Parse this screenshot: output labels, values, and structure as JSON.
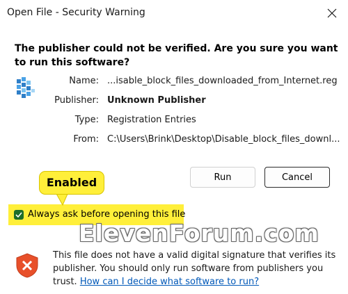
{
  "window": {
    "title": "Open File - Security Warning"
  },
  "question": "The publisher could not be verified.  Are you sure you want to run this software?",
  "details": [
    {
      "label": "Name:",
      "value": "...isable_block_files_downloaded_from_Internet.reg",
      "bold": false
    },
    {
      "label": "Publisher:",
      "value": "Unknown Publisher",
      "bold": true
    },
    {
      "label": "Type:",
      "value": "Registration Entries",
      "bold": false
    },
    {
      "label": "From:",
      "value": "C:\\Users\\Brink\\Desktop\\Disable_block_files_downl...",
      "bold": false
    }
  ],
  "buttons": {
    "run": "Run",
    "cancel": "Cancel"
  },
  "callout": {
    "text": "Enabled",
    "color": "#ffef3a"
  },
  "checkbox": {
    "label": "Always ask before opening this file",
    "checked": true
  },
  "watermark": "ElevenForum.com",
  "footer": {
    "text": "This file does not have a valid digital signature that verifies its publisher.  You should only run software from publishers you trust.",
    "link": "How can I decide what software to run?"
  },
  "icons": {
    "file": "registry-file-icon",
    "shield": "security-shield-icon",
    "close": "close-icon"
  },
  "colors": {
    "link": "#0058b8",
    "checkbox": "#1d6e2a",
    "shield": "#e8502a"
  }
}
